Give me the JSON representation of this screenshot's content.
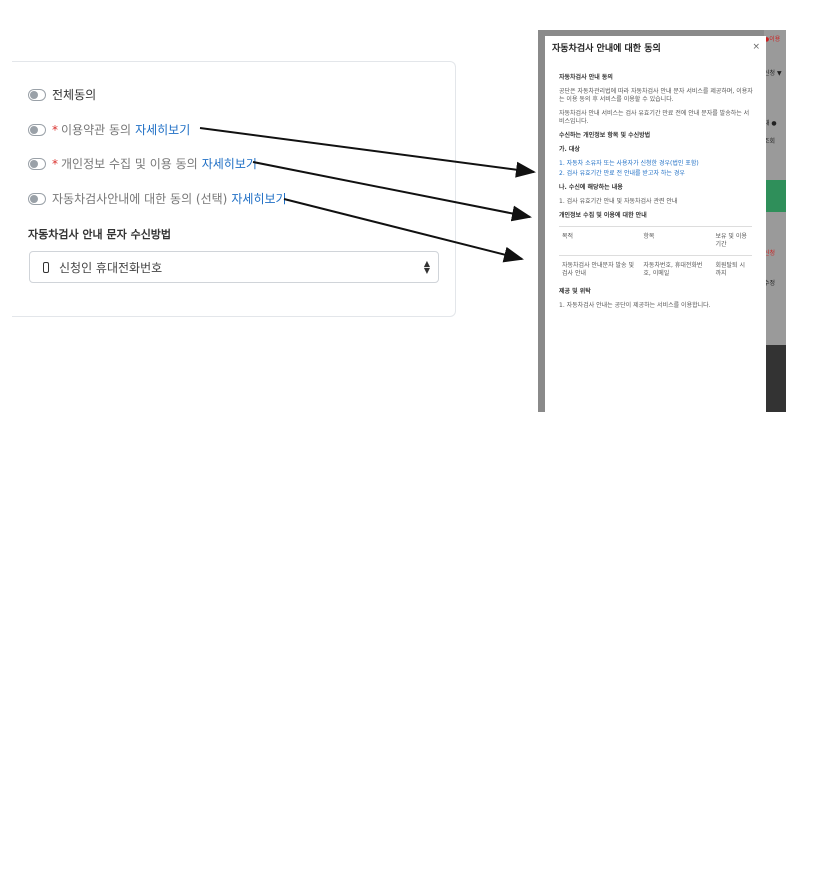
{
  "consent": {
    "all": "전체동의",
    "terms": {
      "req": "*",
      "label": "이용약관 동의",
      "link": "자세히보기"
    },
    "privacy": {
      "req": "*",
      "label": "개인정보 수집 및 이용 동의",
      "link": "자세히보기"
    },
    "notice": {
      "label": "자동차검사안내에 대한 동의 (선택)",
      "link": "자세히보기"
    }
  },
  "method": {
    "title": "자동차검사 안내 문자 수신방법",
    "selected": "신청인 휴대전화번호"
  },
  "background": {
    "line1": "●이용",
    "line2": "신청 ▼",
    "line3": "대 ●",
    "line4": "조회",
    "line5": "신청",
    "line6": "수정"
  },
  "modal": {
    "title": "자동차검사 안내에 대한 동의",
    "close": "×",
    "s1_head": "자동차검사 안내 동의",
    "s1_text": "공단은 자동차관리법에 따라 자동차검사 안내 문자 서비스를 제공하며, 이용자는 이용 동의 후 서비스를 이용할 수 있습니다.",
    "s2_text": "자동차검사 안내 서비스는 검사 유효기간 만료 전에 안내 문자를 발송하는 서비스입니다.",
    "s3_head": "수신하는 개인정보 항목 및 수신방법",
    "s3_a": "가. 대상",
    "s3_b1": "1. 자동차 소유자 또는 사용자가 신청한 경우(법인 포함)",
    "s3_b2": "2. 검사 유효기간 만료 전 안내를 받고자 하는 경우",
    "s4_head": "나. 수신에 해당하는 내용",
    "s4_text": "1. 검사 유효기간 안내 및 자동차검사 관련 안내",
    "s5_head": "개인정보 수집 및 이용에 대한 안내",
    "table": {
      "headers": [
        "목적",
        "항목",
        "보유 및 이용기간"
      ],
      "row": [
        "자동차검사 안내문자 발송 및 검사 안내",
        "자동차번호, 휴대전화번호, 이메일",
        "회원탈퇴 시 까지"
      ]
    },
    "s6_head": "제공 및 위탁",
    "s6_text": "1. 자동차검사 안내는 공단이 제공하는 서비스를 이용합니다."
  }
}
